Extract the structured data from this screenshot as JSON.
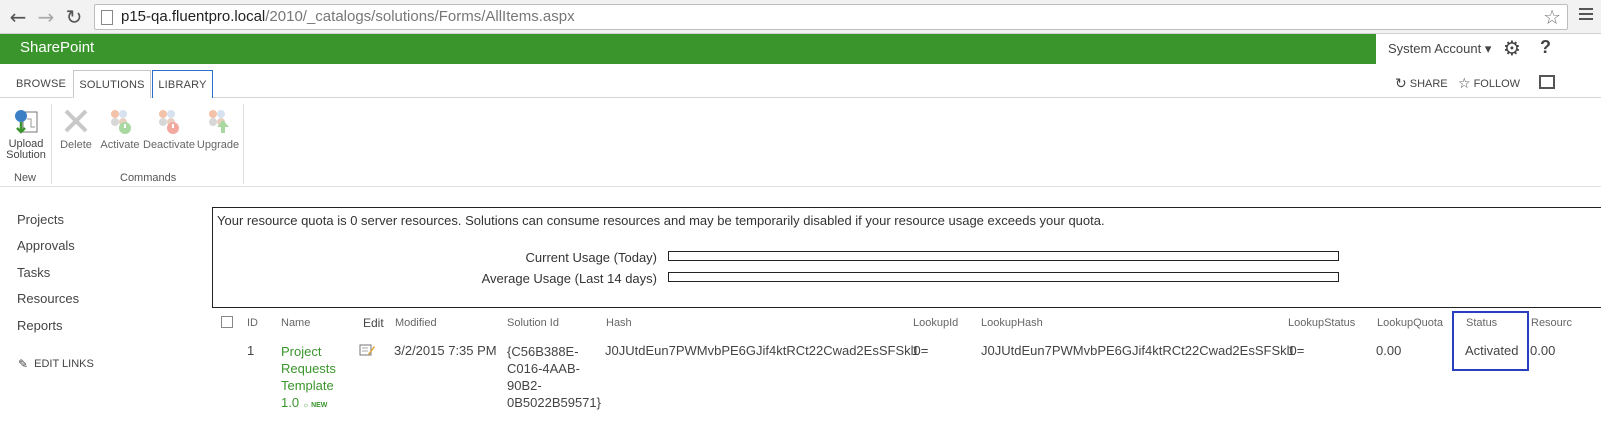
{
  "browser": {
    "url_host": "p15-qa.fluentpro.local",
    "url_path": "/2010/_catalogs/solutions/Forms/AllItems.aspx"
  },
  "suite": {
    "brand": "SharePoint",
    "account": "System Account ▾",
    "help": "?"
  },
  "tabs": {
    "browse": "BROWSE",
    "solutions": "SOLUTIONS",
    "library": "LIBRARY",
    "share": "SHARE",
    "follow": "FOLLOW"
  },
  "ribbon": {
    "upload_l1": "Upload",
    "upload_l2": "Solution",
    "delete": "Delete",
    "activate": "Activate",
    "deactivate": "Deactivate",
    "upgrade": "Upgrade",
    "group_new": "New",
    "group_commands": "Commands"
  },
  "nav": {
    "items": [
      "Projects",
      "Approvals",
      "Tasks",
      "Resources",
      "Reports"
    ],
    "edit_links": "EDIT LINKS"
  },
  "quota": {
    "message": "Your resource quota is 0 server resources. Solutions can consume resources and may be temporarily disabled if your resource usage exceeds your quota.",
    "current_label": "Current Usage (Today)",
    "average_label": "Average Usage (Last 14 days)",
    "current_fill": 0,
    "average_fill": 0
  },
  "table": {
    "headers": {
      "id": "ID",
      "name": "Name",
      "edit": "Edit",
      "modified": "Modified",
      "solution_id": "Solution Id",
      "hash": "Hash",
      "lookupid": "LookupId",
      "lookuphash": "LookupHash",
      "lookupstatus": "LookupStatus",
      "lookupquota": "LookupQuota",
      "status": "Status",
      "resource": "Resourc"
    },
    "row": {
      "id": "1",
      "name_l1": "Project",
      "name_l2": "Requests",
      "name_l3": "Template",
      "name_l4": "1.0",
      "new_badge": "☼ NEW",
      "modified": "3/2/2015 7:35 PM",
      "sid_l1": "{C56B388E-",
      "sid_l2": "C016-4AAB-",
      "sid_l3": "90B2-",
      "sid_l4": "0B5022B59571}",
      "hash": "J0JUtdEun7PWMvbPE6GJif4ktRCt22Cwad2EsSFSkl0=",
      "lookupid": "1",
      "lookuphash": "J0JUtdEun7PWMvbPE6GJif4ktRCt22Cwad2EsSFSkl0=",
      "lookupstatus": "1",
      "lookupquota": "0.00",
      "status": "Activated",
      "resource": "0.00"
    }
  },
  "colors": {
    "brand_green": "#3a962c",
    "highlight_blue": "#2a3fbf"
  }
}
